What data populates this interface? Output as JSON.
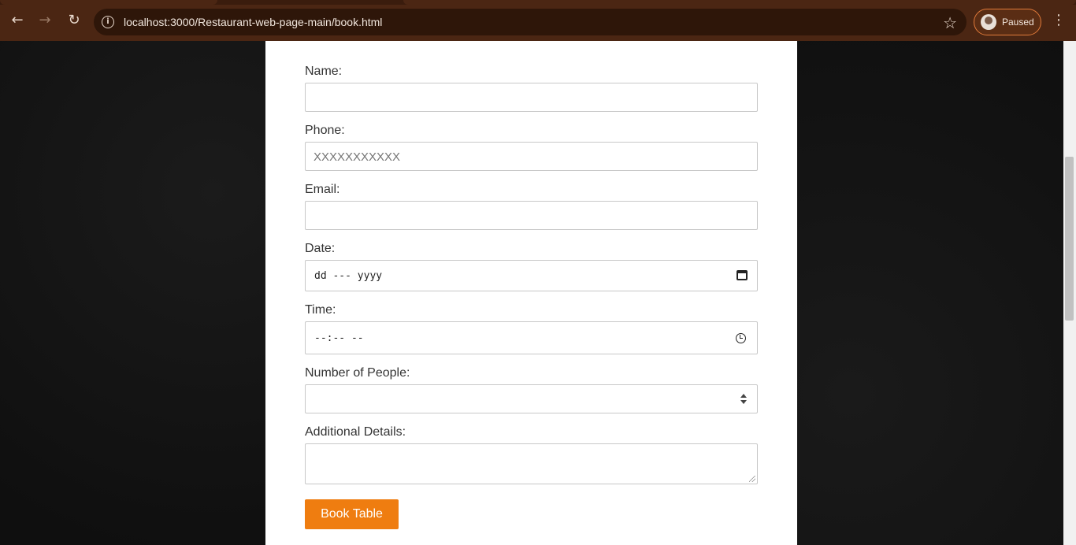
{
  "browser": {
    "url": "localhost:3000/Restaurant-web-page-main/book.html",
    "profile_status": "Paused",
    "icons": [
      "back-arrow-icon",
      "forward-arrow-icon",
      "reload-icon",
      "site-info-icon",
      "bookmark-star-icon",
      "avatar",
      "kebab-menu-icon"
    ]
  },
  "form": {
    "name_label": "Name:",
    "phone_label": "Phone:",
    "phone_placeholder": "XXXXXXXXXXX",
    "email_label": "Email:",
    "date_label": "Date:",
    "date_value": "dd --- yyyy",
    "time_label": "Time:",
    "time_value": "--:-- --",
    "people_label": "Number of People:",
    "details_label": "Additional Details:",
    "submit_label": "Book Table"
  },
  "colors": {
    "accent": "#ef7d10",
    "chrome": "#4b2613",
    "background": "#0f0f0f"
  }
}
